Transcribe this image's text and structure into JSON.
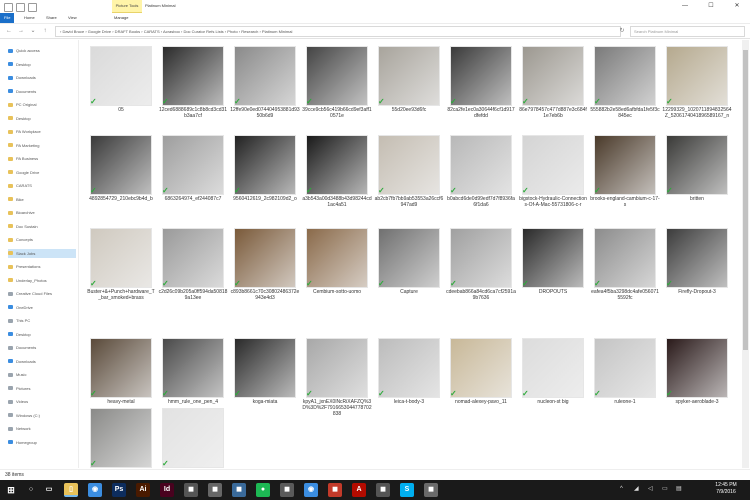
{
  "window": {
    "manage_tab": "Picture Tools",
    "title": "Platinum Minimal",
    "controls": [
      "—",
      "☐",
      "✕"
    ]
  },
  "ribbon": {
    "tabs": [
      "File",
      "Home",
      "Share",
      "View",
      "Manage"
    ]
  },
  "address": {
    "path": "› David Bruce › Google Drive › DRAFT Books › CARATS › Acrasboo › Doc Curator Refs Lists › Photo › Research › Platinum Minimal",
    "search_placeholder": "Search Platinum Minimal"
  },
  "nav": {
    "items": [
      {
        "label": "Quick access",
        "icon": "blue"
      },
      {
        "label": "Desktop",
        "icon": "blue"
      },
      {
        "label": "Downloads",
        "icon": "blue"
      },
      {
        "label": "Documents",
        "icon": "blue"
      },
      {
        "label": "PC Original",
        "icon": "yellow"
      },
      {
        "label": "Desktop",
        "icon": "yellow"
      },
      {
        "label": "PA Workplace",
        "icon": "yellow"
      },
      {
        "label": "PA Marketing",
        "icon": "yellow"
      },
      {
        "label": "PA Business",
        "icon": "yellow"
      },
      {
        "label": "Google Drive",
        "icon": "yellow"
      },
      {
        "label": "CARATS",
        "icon": "yellow"
      },
      {
        "label": "Bike",
        "icon": "yellow"
      },
      {
        "label": "Bioarchive",
        "icon": "yellow"
      },
      {
        "label": "Doc Sustain",
        "icon": "yellow"
      },
      {
        "label": "Concepts",
        "icon": "yellow"
      },
      {
        "label": "Slack Jobs",
        "icon": "yellow"
      },
      {
        "label": "Presentations",
        "icon": "yellow"
      },
      {
        "label": "Underlay_Photos",
        "icon": "yellow"
      },
      {
        "label": "Creative Cloud Files",
        "icon": "gray"
      },
      {
        "label": "OneDrive",
        "icon": "blue"
      },
      {
        "label": "This PC",
        "icon": "gray"
      },
      {
        "label": "Desktop",
        "icon": "blue"
      },
      {
        "label": "Documents",
        "icon": "gray"
      },
      {
        "label": "Downloads",
        "icon": "blue"
      },
      {
        "label": "Music",
        "icon": "gray"
      },
      {
        "label": "Pictures",
        "icon": "gray"
      },
      {
        "label": "Videos",
        "icon": "gray"
      },
      {
        "label": "Windows (C:)",
        "icon": "gray"
      },
      {
        "label": "Network",
        "icon": "gray"
      },
      {
        "label": "Homegroup",
        "icon": "blue"
      }
    ],
    "selected_index": 15
  },
  "files": [
    {
      "label": "05",
      "color": "#dadada"
    },
    {
      "label": "12ced6888689c1c8b8cd3cd31b3aa7cf",
      "color": "#2b2b2b"
    },
    {
      "label": "12ffe90e0ed074404953881d9350b6d9",
      "color": "#8a8a8a"
    },
    {
      "label": "39cce9cb56c419b66cd9ef3aff10571e",
      "color": "#444444"
    },
    {
      "label": "55d20ee93d6fc",
      "color": "#a8a49c"
    },
    {
      "label": "82ca2fe1ec0a30644f6cf1d917dfefdd",
      "color": "#3a3a3a"
    },
    {
      "label": "86e7978457c477d887e3c684f1e7eb6b",
      "color": "#9c9890"
    },
    {
      "label": "555882b2e58ed6afbfda1fe5f3c845ec",
      "color": "#7a7a7a"
    },
    {
      "label": "12299329_1020711894832564Z_5206174041896589167_n",
      "color": "#b5a98e"
    },
    {
      "label": "4892854729_210ebc9b4d_b",
      "color": "#3a3a3a"
    },
    {
      "label": "6863264974_ef244087c7",
      "color": "#9e9e9e"
    },
    {
      "label": "9560412619_2c982109d2_o",
      "color": "#222222"
    },
    {
      "label": "a3b543a00d3488b43d98244cd1ac4a51",
      "color": "#1a1a1a"
    },
    {
      "label": "ab2cb7fb7bb9ab53553a26ccf6947ad9",
      "color": "#c4bdb2"
    },
    {
      "label": "b0abcd6de0d99edf7d7f8936fa6f1da6",
      "color": "#b8b8b8"
    },
    {
      "label": "bigstock-Hydraulic-Connections-Of-A-Mac-55731806-c-r",
      "color": "#d4d4d4"
    },
    {
      "label": "brooks-england-cambium-c-17-s",
      "color": "#4a3a2a"
    },
    {
      "label": "britten",
      "color": "#3a3a38"
    },
    {
      "label": "Buster+&+Punch+hardware_T_bar_smoked+brass",
      "color": "#cfc9bf"
    },
    {
      "label": "c2d26c09b205a0ff594da508189a13ee",
      "color": "#9a9a9a"
    },
    {
      "label": "c893b8661c70c30802486372e943e4d3",
      "color": "#7a5a3a"
    },
    {
      "label": "Cembium-sotto-uomo",
      "color": "#8a6a4a"
    },
    {
      "label": "Capture",
      "color": "#707070"
    },
    {
      "label": "cdeebab866a84cd6ca7cf2591a9b7636",
      "color": "#a0a0a0"
    },
    {
      "label": "DROPOUTS",
      "color": "#2a2a2a"
    },
    {
      "label": "eafea4f5ba3298dc4afe0560715592fc",
      "color": "#8c8c8c"
    },
    {
      "label": "Firefly-Dropout-3",
      "color": "#3c3c3c"
    },
    {
      "label": "heavy-metal",
      "color": "#5a4a3a"
    },
    {
      "label": "hmm_rule_one_pen_4",
      "color": "#4a4a4a"
    },
    {
      "label": "koga-miata",
      "color": "#2a2a2a"
    },
    {
      "label": "kpyA1_jxnEX0lNcRiXAFZQ%3D%3D%2F7916653044778702838",
      "color": "#a8a8a8"
    },
    {
      "label": "leica-t-body-3",
      "color": "#bcbcbc"
    },
    {
      "label": "nomad-alexey-pavo_11",
      "color": "#c8b898"
    },
    {
      "label": "nucleon-st big",
      "color": "#dcdcdc"
    },
    {
      "label": "ruleone-1",
      "color": "#c4c4c4"
    },
    {
      "label": "spyker-aeroblade-3",
      "color": "#2a1a1a"
    },
    {
      "label": "",
      "color": "#8a8a88"
    },
    {
      "label": "",
      "color": "#e2e2e2"
    }
  ],
  "status": {
    "count": "38 items"
  },
  "taskbar": {
    "apps": [
      {
        "name": "explorer-app",
        "glyph": "▯",
        "color": "#e8c25a"
      },
      {
        "name": "chrome-app",
        "glyph": "◉",
        "color": "#3b8de0"
      },
      {
        "name": "photoshop-app",
        "glyph": "Ps",
        "color": "#0d2d5e"
      },
      {
        "name": "illustrator-app",
        "glyph": "Ai",
        "color": "#4a1a00"
      },
      {
        "name": "indesign-app",
        "glyph": "Id",
        "color": "#49021f"
      },
      {
        "name": "app-6",
        "glyph": "◼",
        "color": "#555555"
      },
      {
        "name": "app-7",
        "glyph": "◼",
        "color": "#666666"
      },
      {
        "name": "app-8",
        "glyph": "◼",
        "color": "#3a6a9a"
      },
      {
        "name": "spotify-app",
        "glyph": "●",
        "color": "#1db954"
      },
      {
        "name": "app-10",
        "glyph": "◼",
        "color": "#5a5a5a"
      },
      {
        "name": "app-11",
        "glyph": "◉",
        "color": "#3b8de0"
      },
      {
        "name": "app-12",
        "glyph": "◼",
        "color": "#c23a2a"
      },
      {
        "name": "acrobat-app",
        "glyph": "A",
        "color": "#b30b00"
      },
      {
        "name": "app-14",
        "glyph": "◼",
        "color": "#555555"
      },
      {
        "name": "skype-app",
        "glyph": "S",
        "color": "#00aff0"
      },
      {
        "name": "app-16",
        "glyph": "◼",
        "color": "#6a6a6a"
      }
    ],
    "time": "12:45 PM",
    "date": "7/9/2016"
  }
}
